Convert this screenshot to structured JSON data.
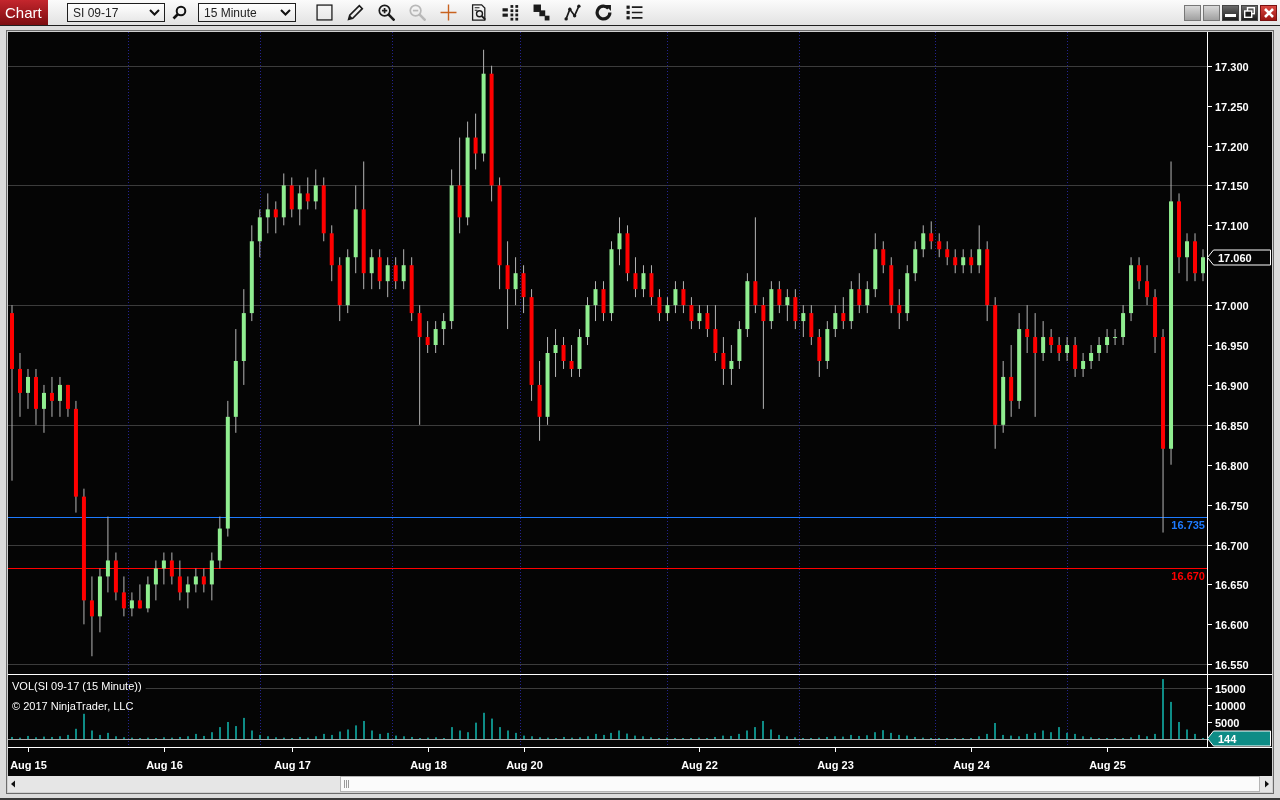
{
  "toolbar": {
    "title": "Chart",
    "instrument": "SI 09-17",
    "interval": "15 Minute",
    "tools": [
      {
        "kind": "box",
        "disabled": false
      },
      {
        "kind": "pencil",
        "disabled": false
      },
      {
        "kind": "zoomin",
        "disabled": false
      },
      {
        "kind": "zoomout",
        "disabled": true
      },
      {
        "kind": "crosshair",
        "disabled": false
      },
      {
        "kind": "properties",
        "disabled": false
      },
      {
        "kind": "spacing",
        "disabled": false
      },
      {
        "kind": "stairs",
        "disabled": false
      },
      {
        "kind": "drawing",
        "disabled": false
      },
      {
        "kind": "refresh",
        "disabled": false
      },
      {
        "kind": "list",
        "disabled": false
      }
    ]
  },
  "chart": {
    "chart_data": [
      {
        "type": "candlestick",
        "ylim": [
          16.539,
          17.341
        ],
        "yticks": [
          {
            "value": 16.55,
            "label": "16.550"
          },
          {
            "value": 16.6,
            "label": "16.600"
          },
          {
            "value": 16.65,
            "label": "16.650"
          },
          {
            "value": 16.7,
            "label": "16.700"
          },
          {
            "value": 16.75,
            "label": "16.750"
          },
          {
            "value": 16.8,
            "label": "16.800"
          },
          {
            "value": 16.85,
            "label": "16.850"
          },
          {
            "value": 16.9,
            "label": "16.900"
          },
          {
            "value": 16.95,
            "label": "16.950"
          },
          {
            "value": 17.0,
            "label": "17.000"
          },
          {
            "value": 17.1,
            "label": "17.100"
          },
          {
            "value": 17.15,
            "label": "17.150"
          },
          {
            "value": 17.2,
            "label": "17.200"
          },
          {
            "value": 17.25,
            "label": "17.250"
          },
          {
            "value": 17.3,
            "label": "17.300"
          }
        ],
        "tick_labels": "y",
        "grid": true,
        "annotations": [
          "17.060"
        ],
        "ref_lines": [
          {
            "axis": "y",
            "value": 16.735,
            "label": "16.735",
            "color": "#1e7bff",
            "line_style": "solid"
          },
          {
            "axis": "y",
            "value": 16.67,
            "label": "16.670",
            "color": "#ff0000",
            "line_style": "solid"
          }
        ],
        "ohlc": [
          [
            16.99,
            17.0,
            16.78,
            16.92
          ],
          [
            16.92,
            16.94,
            16.86,
            16.89
          ],
          [
            16.89,
            16.92,
            16.87,
            16.91
          ],
          [
            16.91,
            16.92,
            16.85,
            16.87
          ],
          [
            16.87,
            16.9,
            16.84,
            16.89
          ],
          [
            16.89,
            16.91,
            16.86,
            16.88
          ],
          [
            16.88,
            16.91,
            16.86,
            16.9
          ],
          [
            16.9,
            16.9,
            16.86,
            16.87
          ],
          [
            16.87,
            16.88,
            16.74,
            16.76
          ],
          [
            16.76,
            16.77,
            16.6,
            16.63
          ],
          [
            16.63,
            16.66,
            16.56,
            16.61
          ],
          [
            16.61,
            16.67,
            16.59,
            16.66
          ],
          [
            16.66,
            16.735,
            16.64,
            16.68
          ],
          [
            16.68,
            16.69,
            16.63,
            16.64
          ],
          [
            16.64,
            16.66,
            16.61,
            16.62
          ],
          [
            16.62,
            16.64,
            16.61,
            16.63
          ],
          [
            16.63,
            16.65,
            16.62,
            16.62
          ],
          [
            16.62,
            16.66,
            16.615,
            16.65
          ],
          [
            16.65,
            16.68,
            16.63,
            16.67
          ],
          [
            16.67,
            16.69,
            16.65,
            16.68
          ],
          [
            16.68,
            16.69,
            16.65,
            16.66
          ],
          [
            16.66,
            16.68,
            16.63,
            16.64
          ],
          [
            16.64,
            16.66,
            16.62,
            16.65
          ],
          [
            16.65,
            16.67,
            16.64,
            16.66
          ],
          [
            16.66,
            16.67,
            16.64,
            16.65
          ],
          [
            16.65,
            16.69,
            16.63,
            16.68
          ],
          [
            16.68,
            16.735,
            16.67,
            16.72
          ],
          [
            16.72,
            16.88,
            16.71,
            16.86
          ],
          [
            16.86,
            16.97,
            16.84,
            16.93
          ],
          [
            16.93,
            17.02,
            16.9,
            16.99
          ],
          [
            16.99,
            17.1,
            16.98,
            17.08
          ],
          [
            17.08,
            17.12,
            17.06,
            17.11
          ],
          [
            17.11,
            17.14,
            17.09,
            17.12
          ],
          [
            17.12,
            17.13,
            17.09,
            17.11
          ],
          [
            17.11,
            17.165,
            17.1,
            17.15
          ],
          [
            17.15,
            17.16,
            17.11,
            17.12
          ],
          [
            17.12,
            17.15,
            17.1,
            17.14
          ],
          [
            17.14,
            17.16,
            17.12,
            17.13
          ],
          [
            17.13,
            17.17,
            17.12,
            17.15
          ],
          [
            17.15,
            17.16,
            17.08,
            17.09
          ],
          [
            17.09,
            17.1,
            17.03,
            17.05
          ],
          [
            17.05,
            17.06,
            16.98,
            17.0
          ],
          [
            17.0,
            17.07,
            16.99,
            17.06
          ],
          [
            17.06,
            17.15,
            17.04,
            17.12
          ],
          [
            17.12,
            17.18,
            17.02,
            17.04
          ],
          [
            17.04,
            17.07,
            17.02,
            17.06
          ],
          [
            17.06,
            17.07,
            17.02,
            17.03
          ],
          [
            17.03,
            17.06,
            17.01,
            17.05
          ],
          [
            17.05,
            17.06,
            17.02,
            17.03
          ],
          [
            17.03,
            17.07,
            17.02,
            17.05
          ],
          [
            17.05,
            17.06,
            16.98,
            16.99
          ],
          [
            16.99,
            17.0,
            16.85,
            16.96
          ],
          [
            16.96,
            16.98,
            16.94,
            16.95
          ],
          [
            16.95,
            16.98,
            16.94,
            16.97
          ],
          [
            16.97,
            16.99,
            16.95,
            16.98
          ],
          [
            16.98,
            17.17,
            16.97,
            17.15
          ],
          [
            17.15,
            17.21,
            17.09,
            17.11
          ],
          [
            17.11,
            17.23,
            17.1,
            17.21
          ],
          [
            17.21,
            17.24,
            17.17,
            17.19
          ],
          [
            17.19,
            17.32,
            17.18,
            17.29
          ],
          [
            17.29,
            17.3,
            17.13,
            17.15
          ],
          [
            17.15,
            17.16,
            17.02,
            17.05
          ],
          [
            17.05,
            17.08,
            16.97,
            17.02
          ],
          [
            17.02,
            17.06,
            17.0,
            17.04
          ],
          [
            17.04,
            17.05,
            16.99,
            17.01
          ],
          [
            17.01,
            17.02,
            16.88,
            16.9
          ],
          [
            16.9,
            16.93,
            16.83,
            16.86
          ],
          [
            16.86,
            16.96,
            16.85,
            16.94
          ],
          [
            16.94,
            16.97,
            16.91,
            16.95
          ],
          [
            16.95,
            16.96,
            16.92,
            16.93
          ],
          [
            16.93,
            16.95,
            16.91,
            16.92
          ],
          [
            16.92,
            16.97,
            16.91,
            16.96
          ],
          [
            16.96,
            17.01,
            16.95,
            17.0
          ],
          [
            17.0,
            17.03,
            16.98,
            17.02
          ],
          [
            17.02,
            17.03,
            16.98,
            16.99
          ],
          [
            16.99,
            17.08,
            16.98,
            17.07
          ],
          [
            17.07,
            17.11,
            17.05,
            17.09
          ],
          [
            17.09,
            17.1,
            17.03,
            17.04
          ],
          [
            17.04,
            17.06,
            17.01,
            17.02
          ],
          [
            17.02,
            17.05,
            17.01,
            17.04
          ],
          [
            17.04,
            17.05,
            17.0,
            17.01
          ],
          [
            17.01,
            17.02,
            16.98,
            16.99
          ],
          [
            16.99,
            17.01,
            16.98,
            17.0
          ],
          [
            17.0,
            17.03,
            16.99,
            17.02
          ],
          [
            17.02,
            17.03,
            16.99,
            17.0
          ],
          [
            17.0,
            17.01,
            16.97,
            16.98
          ],
          [
            16.98,
            17.0,
            16.97,
            16.99
          ],
          [
            16.99,
            17.0,
            16.96,
            16.97
          ],
          [
            16.97,
            17.0,
            16.93,
            16.94
          ],
          [
            16.94,
            16.96,
            16.9,
            16.92
          ],
          [
            16.92,
            16.95,
            16.9,
            16.93
          ],
          [
            16.93,
            16.98,
            16.92,
            16.97
          ],
          [
            16.97,
            17.04,
            16.96,
            17.03
          ],
          [
            17.03,
            17.11,
            16.99,
            17.0
          ],
          [
            17.0,
            17.01,
            16.87,
            16.98
          ],
          [
            16.98,
            17.03,
            16.97,
            17.02
          ],
          [
            17.02,
            17.03,
            16.99,
            17.0
          ],
          [
            17.0,
            17.02,
            16.98,
            17.01
          ],
          [
            17.01,
            17.02,
            16.97,
            16.98
          ],
          [
            16.98,
            17.0,
            16.96,
            16.99
          ],
          [
            16.99,
            17.0,
            16.95,
            16.96
          ],
          [
            16.96,
            16.97,
            16.91,
            16.93
          ],
          [
            16.93,
            16.98,
            16.92,
            16.97
          ],
          [
            16.97,
            17.0,
            16.96,
            16.99
          ],
          [
            16.99,
            17.01,
            16.97,
            16.98
          ],
          [
            16.98,
            17.03,
            16.97,
            17.02
          ],
          [
            17.02,
            17.04,
            16.99,
            17.0
          ],
          [
            17.0,
            17.03,
            16.99,
            17.02
          ],
          [
            17.02,
            17.09,
            17.01,
            17.07
          ],
          [
            17.07,
            17.08,
            17.04,
            17.05
          ],
          [
            17.05,
            17.06,
            16.99,
            17.0
          ],
          [
            17.0,
            17.02,
            16.97,
            16.99
          ],
          [
            16.99,
            17.05,
            16.98,
            17.04
          ],
          [
            17.04,
            17.08,
            17.03,
            17.07
          ],
          [
            17.07,
            17.1,
            17.06,
            17.09
          ],
          [
            17.09,
            17.105,
            17.07,
            17.08
          ],
          [
            17.08,
            17.09,
            17.06,
            17.07
          ],
          [
            17.07,
            17.08,
            17.05,
            17.06
          ],
          [
            17.06,
            17.07,
            17.04,
            17.05
          ],
          [
            17.05,
            17.07,
            17.04,
            17.06
          ],
          [
            17.06,
            17.07,
            17.04,
            17.05
          ],
          [
            17.05,
            17.1,
            17.04,
            17.07
          ],
          [
            17.07,
            17.08,
            16.98,
            17.0
          ],
          [
            17.0,
            17.01,
            16.82,
            16.85
          ],
          [
            16.85,
            16.93,
            16.84,
            16.91
          ],
          [
            16.91,
            16.95,
            16.86,
            16.88
          ],
          [
            16.88,
            16.99,
            16.87,
            16.97
          ],
          [
            16.97,
            17.0,
            16.94,
            16.96
          ],
          [
            16.96,
            16.99,
            16.86,
            16.94
          ],
          [
            16.94,
            16.98,
            16.93,
            16.96
          ],
          [
            16.96,
            16.97,
            16.94,
            16.95
          ],
          [
            16.95,
            16.96,
            16.93,
            16.94
          ],
          [
            16.94,
            16.96,
            16.93,
            16.95
          ],
          [
            16.95,
            16.96,
            16.91,
            16.92
          ],
          [
            16.92,
            16.94,
            16.91,
            16.93
          ],
          [
            16.93,
            16.95,
            16.92,
            16.94
          ],
          [
            16.94,
            16.96,
            16.93,
            16.95
          ],
          [
            16.95,
            16.97,
            16.94,
            16.96
          ],
          [
            16.96,
            16.97,
            16.95,
            16.96
          ],
          [
            16.96,
            17.0,
            16.95,
            16.99
          ],
          [
            16.99,
            17.06,
            16.98,
            17.05
          ],
          [
            17.05,
            17.06,
            17.02,
            17.03
          ],
          [
            17.03,
            17.05,
            17.0,
            17.01
          ],
          [
            17.01,
            17.02,
            16.94,
            16.96
          ],
          [
            16.96,
            16.97,
            16.715,
            16.82
          ],
          [
            16.82,
            17.18,
            16.8,
            17.13
          ],
          [
            17.13,
            17.14,
            17.04,
            17.06
          ],
          [
            17.06,
            17.09,
            17.03,
            17.08
          ],
          [
            17.08,
            17.09,
            17.03,
            17.04
          ],
          [
            17.04,
            17.07,
            17.03,
            17.06
          ]
        ]
      },
      {
        "type": "bar",
        "title": "VOL(SI 09-17 (15 Minute))",
        "annotations": [
          "© 2017 NinjaTrader, LLC"
        ],
        "color": "#0e8c86",
        "ylim": [
          0,
          18800
        ],
        "yticks": [
          5000,
          10000,
          15000
        ],
        "ref_lines": [
          {
            "axis": "y",
            "value": 15000,
            "color": "#3c3c3c",
            "line_style": "solid"
          },
          {
            "axis": "y",
            "value": 144,
            "label": "144",
            "color": "#a8a8a8",
            "line_style": "solid"
          }
        ],
        "categories": [
          null,
          null,
          "Aug 15",
          null,
          null,
          null,
          null,
          null,
          null,
          null,
          null,
          null,
          null,
          null,
          null,
          null,
          null,
          null,
          null,
          "Aug 16",
          null,
          null,
          null,
          null,
          null,
          null,
          null,
          null,
          null,
          null,
          null,
          null,
          null,
          null,
          null,
          "Aug 17",
          null,
          null,
          null,
          null,
          null,
          null,
          null,
          null,
          null,
          null,
          null,
          null,
          null,
          null,
          null,
          null,
          "Aug 18",
          null,
          null,
          null,
          null,
          null,
          null,
          null,
          null,
          null,
          null,
          null,
          "Aug 20",
          null,
          null,
          null,
          null,
          null,
          null,
          null,
          null,
          null,
          null,
          null,
          null,
          null,
          null,
          null,
          null,
          null,
          null,
          null,
          null,
          null,
          "Aug 22",
          null,
          null,
          null,
          null,
          null,
          null,
          null,
          null,
          null,
          null,
          null,
          null,
          null,
          null,
          null,
          null,
          "Aug 23",
          null,
          null,
          null,
          null,
          null,
          null,
          null,
          null,
          null,
          null,
          null,
          null,
          null,
          null,
          null,
          null,
          "Aug 24",
          null,
          null,
          null,
          null,
          null,
          null,
          null,
          null,
          null,
          null,
          null,
          null,
          null,
          null,
          null,
          null,
          "Aug 25",
          null,
          null,
          null,
          null,
          null,
          null,
          null,
          null,
          null,
          null,
          null,
          null
        ],
        "values": [
          600,
          400,
          900,
          500,
          700,
          600,
          800,
          1200,
          3000,
          7400,
          2500,
          1200,
          1800,
          800,
          500,
          400,
          300,
          400,
          300,
          500,
          400,
          600,
          800,
          1500,
          900,
          2000,
          3500,
          5000,
          3800,
          6200,
          2500,
          1200,
          800,
          500,
          400,
          300,
          600,
          400,
          800,
          1500,
          1200,
          2200,
          2800,
          4000,
          5300,
          2500,
          1500,
          1800,
          1000,
          800,
          600,
          300,
          400,
          500,
          300,
          3500,
          2500,
          2000,
          4800,
          7700,
          6000,
          3500,
          2500,
          1800,
          1000,
          800,
          500,
          400,
          300,
          600,
          400,
          500,
          800,
          1500,
          1200,
          1800,
          2500,
          1600,
          1000,
          800,
          500,
          300,
          400,
          300,
          200,
          300,
          400,
          300,
          600,
          1000,
          900,
          1500,
          2500,
          3500,
          5300,
          2800,
          1200,
          800,
          500,
          300,
          300,
          400,
          600,
          800,
          700,
          1200,
          900,
          1100,
          2000,
          2600,
          1800,
          1200,
          1000,
          600,
          400,
          300,
          300,
          200,
          300,
          200,
          300,
          800,
          1500,
          4700,
          1200,
          1000,
          800,
          1500,
          1800,
          2500,
          2000,
          3500,
          1800,
          1500,
          800,
          500,
          300,
          300,
          200,
          300,
          500,
          1200,
          800,
          1500,
          17600,
          10900,
          5000,
          2800,
          1500,
          100
        ]
      }
    ]
  }
}
